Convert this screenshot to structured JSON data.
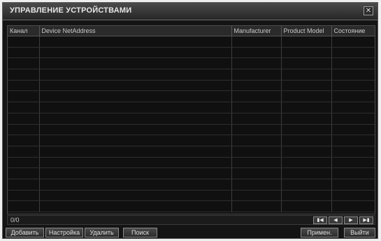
{
  "window": {
    "title": "УПРАВЛЕНИЕ УСТРОЙСТВАМИ",
    "close_glyph": "✕"
  },
  "table": {
    "columns": [
      "Канал",
      "Device NetAddress",
      "Manufacturer",
      "Product Model",
      "Состояние"
    ],
    "row_count": 16
  },
  "footer": {
    "page_count": "0/0"
  },
  "pager": {
    "first": "▮◀",
    "prev": "◀",
    "next": "▶",
    "last": "▶▮"
  },
  "buttons": {
    "add": "Добавить",
    "settings": "Настройка",
    "delete": "Удалить",
    "search": "Поиск",
    "apply": "Примен.",
    "exit": "Выйти"
  }
}
